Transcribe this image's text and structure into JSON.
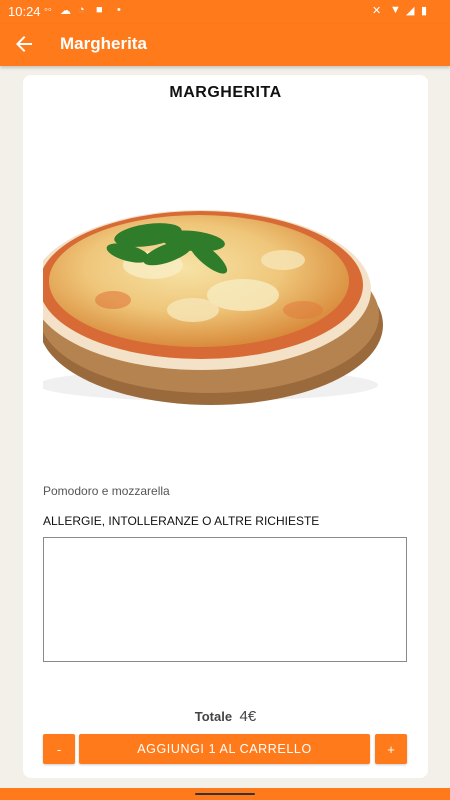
{
  "status_bar": {
    "time": "10:24"
  },
  "app_bar": {
    "title": "Margherita"
  },
  "product": {
    "title": "MARGHERITA",
    "description": "Pomodoro e mozzarella"
  },
  "allergy": {
    "label": "ALLERGIE, INTOLLERANZE O ALTRE RICHIESTE",
    "value": ""
  },
  "total": {
    "label": "Totale",
    "value": "4€"
  },
  "buttons": {
    "minus": "-",
    "add_to_cart": "AGGIUNGI 1 AL CARRELLO",
    "plus": "+"
  },
  "colors": {
    "accent": "#ff7a1a",
    "background": "#f3f0ea"
  }
}
